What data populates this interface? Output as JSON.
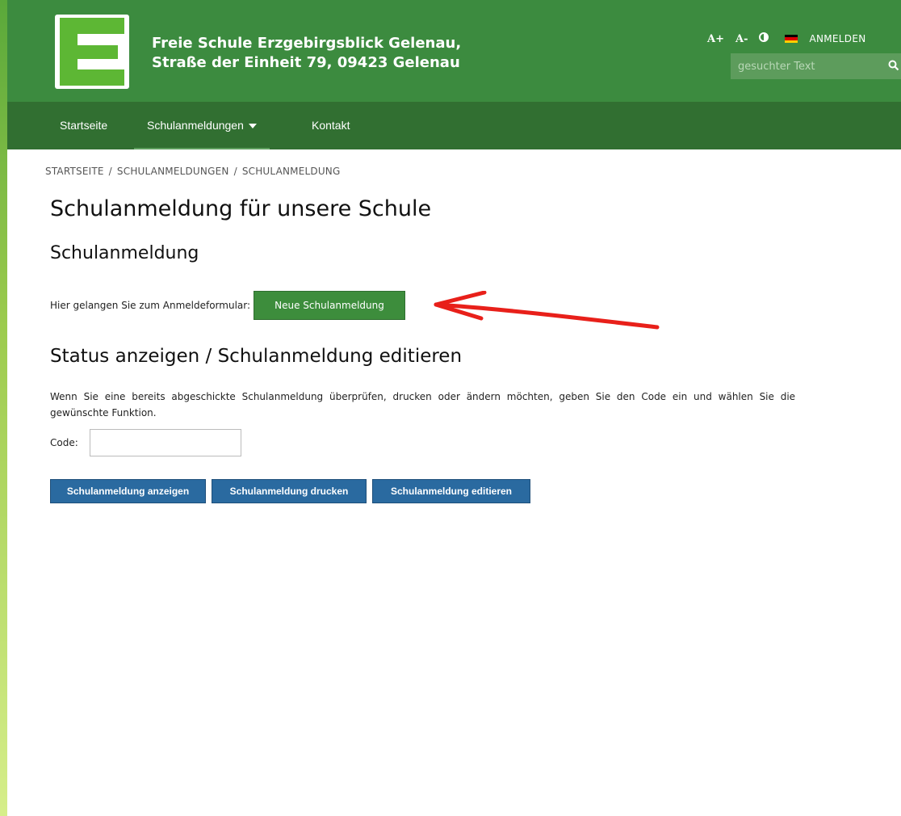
{
  "header": {
    "school_line1": "Freie Schule Erzgebirgsblick Gelenau,",
    "school_line2": "Straße der Einheit 79, 09423 Gelenau",
    "logo_letter": "E",
    "font_increase": "A+",
    "font_decrease": "A-",
    "contrast_icon": "contrast-icon",
    "language_flag": "german-flag-icon",
    "login_label": "ANMELDEN",
    "search_placeholder": "gesuchter Text",
    "search_icon": "search-icon"
  },
  "nav": {
    "items": [
      {
        "label": "Startseite"
      },
      {
        "label": "Schulanmeldungen"
      },
      {
        "label": "Kontakt"
      }
    ]
  },
  "breadcrumb": {
    "items": [
      "STARTSEITE",
      "SCHULANMELDUNGEN",
      "SCHULANMELDUNG"
    ],
    "separator": "/"
  },
  "main": {
    "page_title": "Schulanmeldung für unsere Schule",
    "section_title": "Schulanmeldung",
    "intro_text": "Hier gelangen Sie zum Anmeldeformular:",
    "new_button": "Neue Schulanmeldung",
    "status_title": "Status anzeigen / Schulanmeldung editieren",
    "desc_line1": "Wenn Sie eine bereits abgeschickte Schulanmeldung überprüfen, drucken oder ändern möchten, geben Sie den Code ein und wählen Sie die",
    "desc_line2": "gewünschte Funktion.",
    "code_label": "Code:",
    "code_value": "",
    "buttons": [
      {
        "label": "Schulanmeldung anzeigen"
      },
      {
        "label": "Schulanmeldung drucken"
      },
      {
        "label": "Schulanmeldung editieren"
      }
    ]
  },
  "colors": {
    "header_green": "#3c8b3f",
    "nav_green": "#316f31",
    "button_green": "#3d8d3c",
    "button_blue": "#2a6aa0",
    "annotation_arrow": "#e8201a"
  }
}
